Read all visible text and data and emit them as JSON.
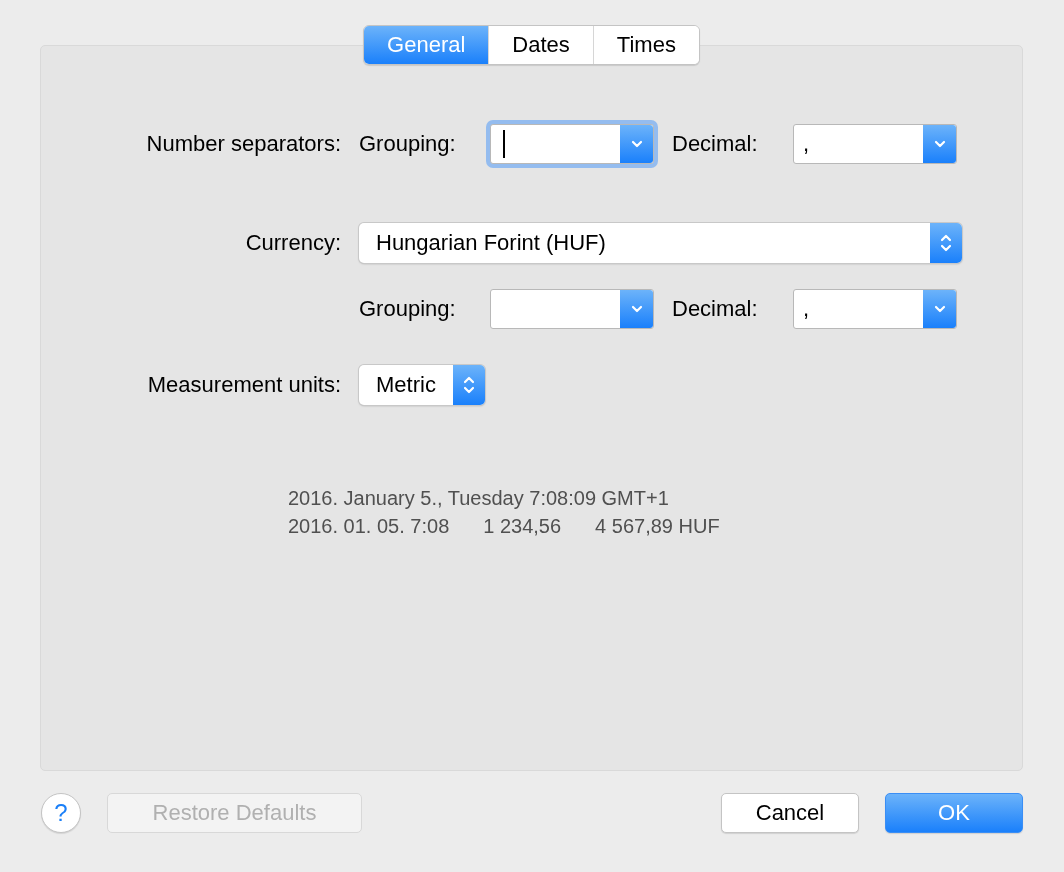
{
  "tabs": [
    {
      "label": "General",
      "selected": true
    },
    {
      "label": "Dates",
      "selected": false
    },
    {
      "label": "Times",
      "selected": false
    }
  ],
  "number_separators": {
    "label": "Number separators:",
    "grouping": {
      "label": "Grouping:",
      "focused": true
    },
    "decimal": {
      "label": "Decimal:",
      "value": ",",
      "focused": false
    }
  },
  "currency": {
    "label": "Currency:",
    "value": "Hungarian Forint (HUF)"
  },
  "currency_separators": {
    "grouping": {
      "label": "Grouping:",
      "focused": false
    },
    "decimal": {
      "label": "Decimal:",
      "value": ",",
      "focused": false
    }
  },
  "measurement_units": {
    "label": "Measurement units:",
    "value": "Metric"
  },
  "preview": {
    "line_1": "2016. January 5., Tuesday 7:08:09 GMT+1",
    "line_2": [
      "2016. 01. 05. 7:08",
      "1 234,56",
      "4 567,89 HUF"
    ]
  },
  "footer": {
    "help": "?",
    "restore_defaults": {
      "label": "Restore Defaults",
      "disabled": true
    },
    "cancel": {
      "label": "Cancel",
      "default": false
    },
    "ok": {
      "label": "OK",
      "default": true
    }
  }
}
